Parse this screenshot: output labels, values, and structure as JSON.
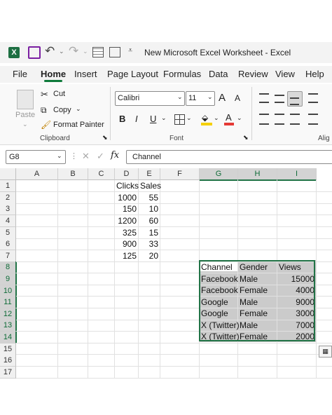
{
  "titlebar": {
    "app_icon": "excel-logo",
    "title": "New Microsoft Excel Worksheet  -  Excel",
    "quick_access": [
      "save-icon",
      "undo-icon",
      "redo-icon",
      "table-icon",
      "form-icon",
      "customize-icon"
    ]
  },
  "menu": {
    "items": [
      "File",
      "Home",
      "Insert",
      "Page Layout",
      "Formulas",
      "Data",
      "Review",
      "View",
      "Help"
    ],
    "active": "Home"
  },
  "ribbon": {
    "clipboard": {
      "paste": "Paste",
      "cut": "Cut",
      "copy": "Copy",
      "format_painter": "Format Painter",
      "label": "Clipboard"
    },
    "font": {
      "font_name": "Calibri",
      "font_size": "11",
      "bold": "B",
      "italic": "I",
      "underline": "U",
      "grow": "A",
      "shrink": "A",
      "label": "Font",
      "font_color": "#e53935",
      "fill_color": "#f5d000"
    },
    "alignment": {
      "label": "Alig"
    }
  },
  "formula_bar": {
    "name_box": "G8",
    "fx": "fx",
    "content": "Channel"
  },
  "grid": {
    "columns": [
      "A",
      "B",
      "C",
      "D",
      "E",
      "F",
      "G",
      "H",
      "I"
    ],
    "rows": [
      "1",
      "2",
      "3",
      "4",
      "5",
      "6",
      "7",
      "8",
      "9",
      "10",
      "11",
      "12",
      "13",
      "14",
      "15",
      "16",
      "17"
    ],
    "table1": {
      "headers": [
        "Clicks",
        "Sales"
      ],
      "rows": [
        [
          "1000",
          "55"
        ],
        [
          "150",
          "10"
        ],
        [
          "1200",
          "60"
        ],
        [
          "325",
          "15"
        ],
        [
          "900",
          "33"
        ],
        [
          "125",
          "20"
        ]
      ]
    },
    "table2": {
      "headers": [
        "Channel",
        "Gender",
        "Views"
      ],
      "rows": [
        [
          "Facebook",
          "Male",
          "15000"
        ],
        [
          "Facebook",
          "Female",
          "4000"
        ],
        [
          "Google",
          "Male",
          "9000"
        ],
        [
          "Google",
          "Female",
          "3000"
        ],
        [
          "X (Twitter)",
          "Male",
          "7000"
        ],
        [
          "X (Twitter)",
          "Female",
          "2000"
        ]
      ]
    },
    "quick_analysis_icon": "quick-analysis-icon",
    "accent": "#217346"
  }
}
